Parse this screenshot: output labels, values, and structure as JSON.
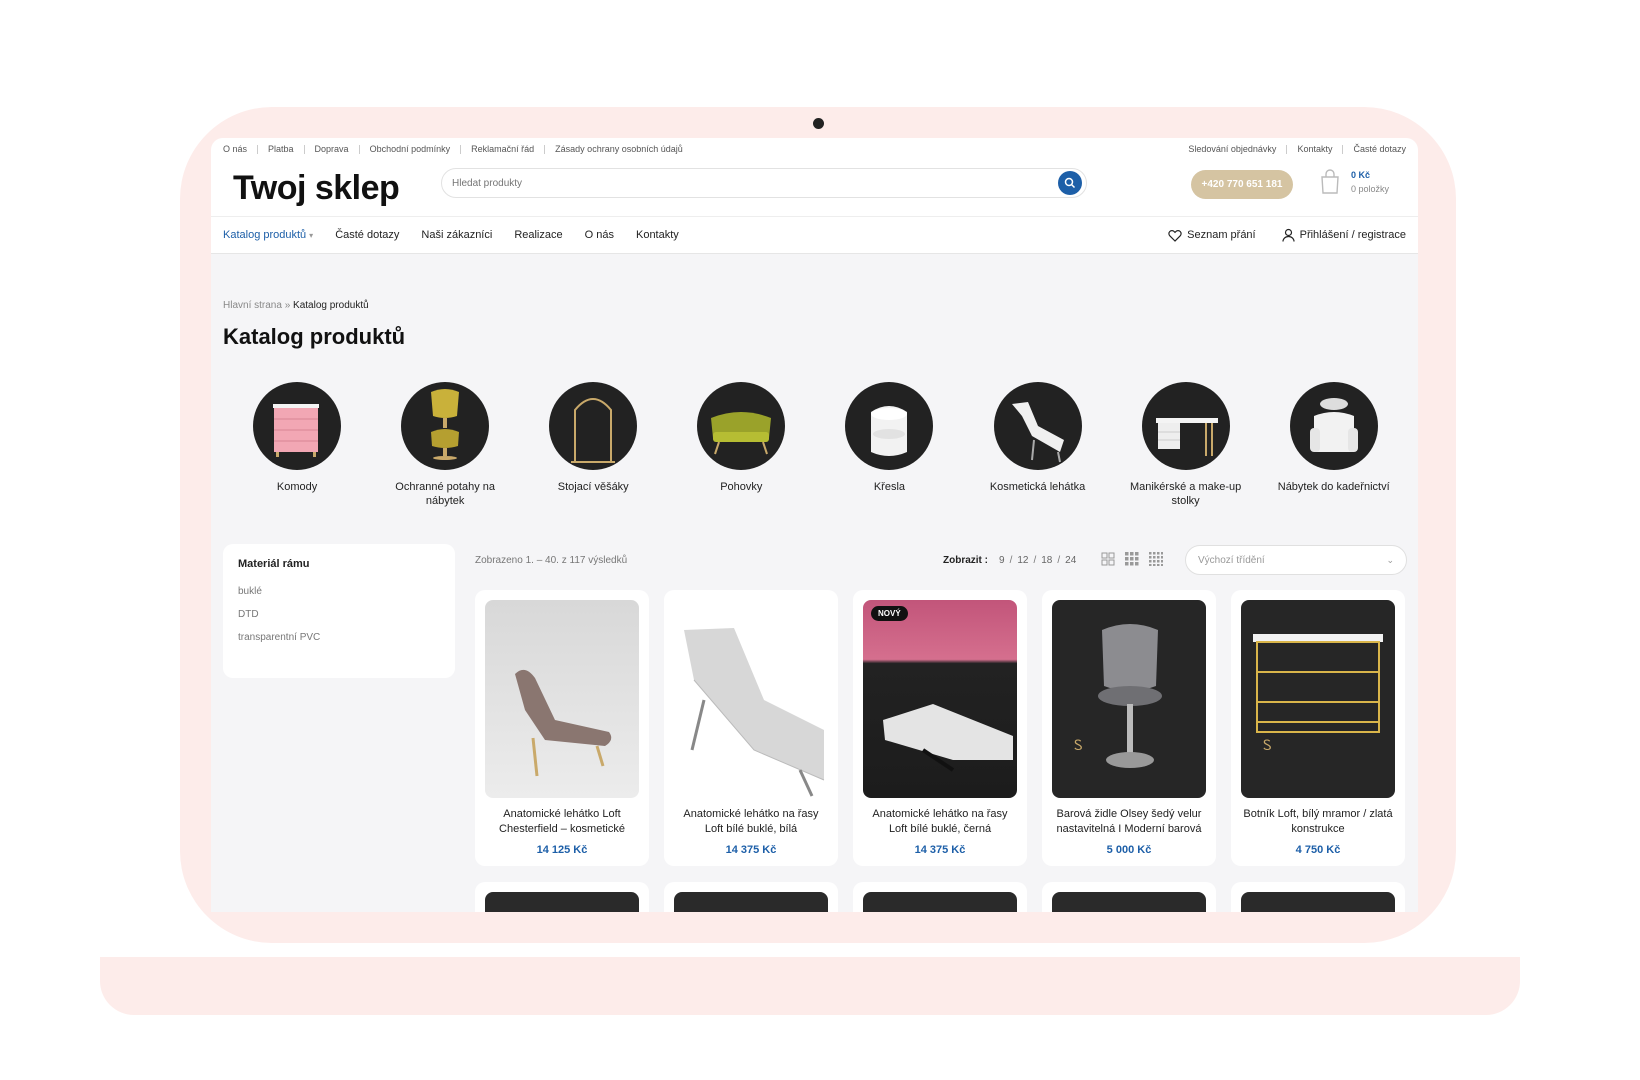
{
  "topbar": {
    "left_links": [
      "O nás",
      "Platba",
      "Doprava",
      "Obchodní podmínky",
      "Reklamační řád",
      "Zásady ochrany osobních údajů"
    ],
    "right_links": [
      "Sledování objednávky",
      "Kontakty",
      "Časté dotazy"
    ]
  },
  "header": {
    "logo": "Twoj sklep",
    "search_placeholder": "Hledat produkty",
    "phone": "+420 770 651 181",
    "cart_total": "0 Kč",
    "cart_count": "0 položky"
  },
  "nav": {
    "items": [
      "Katalog produktů",
      "Časté dotazy",
      "Naši zákazníci",
      "Realizace",
      "O nás",
      "Kontakty"
    ],
    "active": "Katalog produktů",
    "wishlist": "Seznam přání",
    "login": "Přihlášení / registrace"
  },
  "breadcrumb": {
    "home": "Hlavní strana",
    "separator": " » ",
    "current": "Katalog produktů"
  },
  "page_title": "Katalog produktů",
  "categories": [
    {
      "label": "Komody",
      "icon": "dresser"
    },
    {
      "label": "Ochranné potahy na nábytek",
      "icon": "chair-cover"
    },
    {
      "label": "Stojací věšáky",
      "icon": "rack"
    },
    {
      "label": "Pohovky",
      "icon": "sofa"
    },
    {
      "label": "Křesla",
      "icon": "armchair"
    },
    {
      "label": "Kosmetická lehátka",
      "icon": "beauty-bed"
    },
    {
      "label": "Manikérské a make-up stolky",
      "icon": "desk"
    },
    {
      "label": "Nábytek do kadeřnictví",
      "icon": "salon-chair"
    }
  ],
  "sidebar": {
    "title": "Materiál rámu",
    "filters": [
      "buklé",
      "DTD",
      "transparentní PVC"
    ]
  },
  "toolbar": {
    "results": "Zobrazeno 1. – 40. z 117 výsledků",
    "show_label": "Zobrazit :",
    "show_options": [
      "9",
      "12",
      "18",
      "24"
    ],
    "sort_label": "Výchozí třídění"
  },
  "products": [
    {
      "name": "Anatomické lehátko Loft Chesterfield – kosmetické",
      "price": "14 125 Kč",
      "badge": ""
    },
    {
      "name": "Anatomické lehátko na řasy Loft bílé buklé, bílá",
      "price": "14 375 Kč",
      "badge": ""
    },
    {
      "name": "Anatomické lehátko na řasy Loft bílé buklé, černá",
      "price": "14 375 Kč",
      "badge": "NOVÝ"
    },
    {
      "name": "Barová židle Olsey šedý velur nastavitelná I Moderní barová",
      "price": "5 000 Kč",
      "badge": ""
    },
    {
      "name": "Botník Loft, bílý mramor / zlatá konstrukce",
      "price": "4 750 Kč",
      "badge": ""
    }
  ],
  "colors": {
    "accent": "#1d5fa8",
    "phone_button": "#d5c4a2",
    "frame": "#fdecea"
  }
}
